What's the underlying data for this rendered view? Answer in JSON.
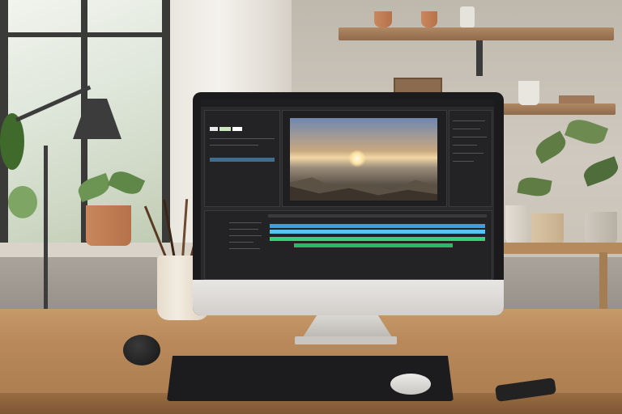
{
  "scene": {
    "subject": "desktop-computer",
    "screen_app": {
      "menu_text": "",
      "timeline_colors": [
        "#3aa0e6",
        "#56c4f2",
        "#34d27a",
        "#2bb86a"
      ]
    },
    "accent_colors": {
      "desk": "#c79a6a",
      "monitor_bezel": "#1b1b1d",
      "monitor_chin": "#e2e0dc",
      "plant": "#5f7c45"
    }
  }
}
